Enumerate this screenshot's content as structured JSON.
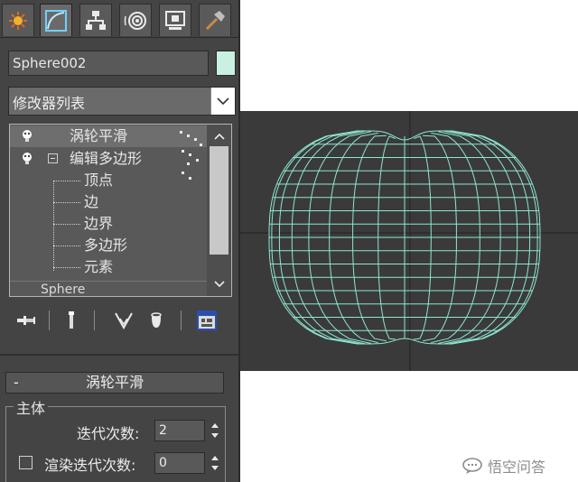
{
  "panel": {
    "tabs": [
      {
        "icon": "create-icon",
        "active": false
      },
      {
        "icon": "modify-icon",
        "active": true
      },
      {
        "icon": "hierarchy-icon",
        "active": false
      },
      {
        "icon": "motion-icon",
        "active": false
      },
      {
        "icon": "display-icon",
        "active": false
      },
      {
        "icon": "utilities-icon",
        "active": false
      }
    ],
    "object_name": "Sphere002",
    "object_color": "#c9f0e0",
    "modifier_list": {
      "label": "修改器列表"
    },
    "stack": {
      "items": [
        {
          "label": "涡轮平滑",
          "level": 0,
          "has_bulb": true,
          "selected": true
        },
        {
          "label": "编辑多边形",
          "level": 0,
          "has_bulb": true,
          "expanded": true
        },
        {
          "label": "顶点",
          "level": 1
        },
        {
          "label": "边",
          "level": 1
        },
        {
          "label": "边界",
          "level": 1
        },
        {
          "label": "多边形",
          "level": 1
        },
        {
          "label": "元素",
          "level": 1
        }
      ],
      "base_object": "Sphere"
    },
    "rollout": {
      "minus": "-",
      "title": "涡轮平滑",
      "group_title": "主体",
      "iterations_label": "迭代次数:",
      "iterations_value": "2",
      "render_iters_label": "渲染迭代次数:",
      "render_iters_value": "0",
      "render_iters_checked": false
    }
  },
  "viewport": {
    "background": "#3a3a3a",
    "wire_color": "#8ee6d2"
  },
  "watermark": {
    "text": "悟空问答"
  }
}
